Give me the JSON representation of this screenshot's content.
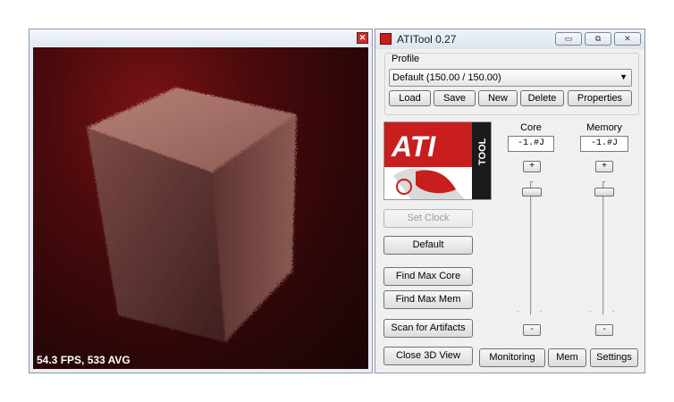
{
  "view_window": {
    "fps_text": "54.3 FPS, 533 AVG",
    "close_glyph": "✕"
  },
  "tool_window": {
    "title": "ATITool 0.27",
    "title_buttons": {
      "minimize": "▭",
      "restore": "⧉",
      "close": "✕"
    },
    "profile": {
      "group_label": "Profile",
      "selected": "Default (150.00 / 150.00)",
      "buttons": [
        "Load",
        "Save",
        "New",
        "Delete",
        "Properties"
      ]
    },
    "logo": {
      "brand": "ATI",
      "suffix": "TOOL"
    },
    "columns": {
      "core": {
        "label": "Core",
        "value": "-1.#J",
        "plus": "+",
        "minus": "-",
        "level": 0.95
      },
      "memory": {
        "label": "Memory",
        "value": "-1.#J",
        "plus": "+",
        "minus": "-",
        "level": 0.95
      }
    },
    "actions": {
      "set_clock": "Set Clock",
      "default": "Default",
      "find_max_core": "Find Max Core",
      "find_max_mem": "Find Max Mem",
      "scan_artifacts": "Scan for Artifacts",
      "close_3d": "Close 3D View"
    },
    "bottom": {
      "monitoring": "Monitoring",
      "mem": "Mem",
      "settings": "Settings"
    }
  },
  "colors": {
    "accent_red": "#c81e1e",
    "window_bg": "#f0f0f0"
  },
  "icons": {
    "app": "ati-app-icon",
    "dropdown": "chevron-down-icon"
  }
}
